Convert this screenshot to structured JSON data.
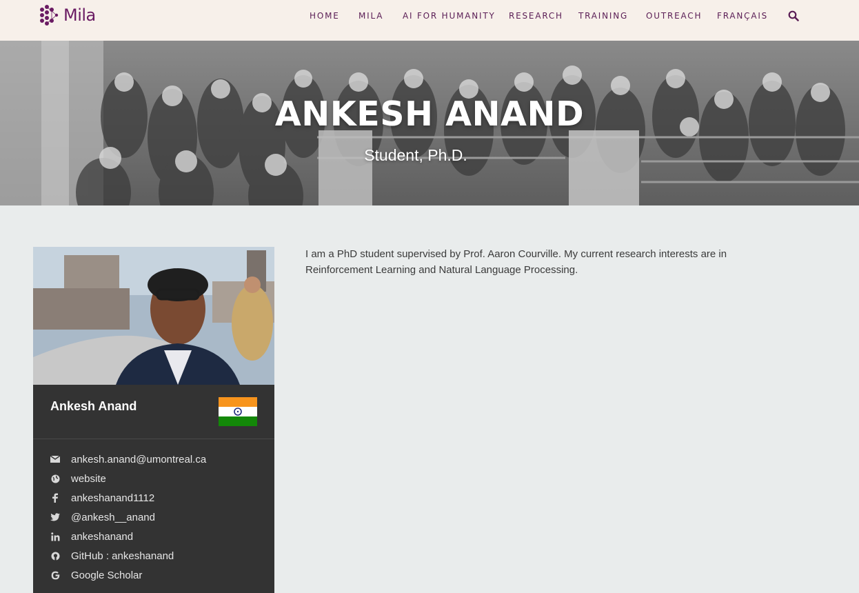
{
  "header": {
    "logo_text": "Mila",
    "nav": [
      {
        "label": "HOME"
      },
      {
        "label": "MILA"
      },
      {
        "label": "AI FOR HUMANITY"
      },
      {
        "label": "RESEARCH"
      },
      {
        "label": "TRAINING"
      },
      {
        "label": "OUTREACH"
      },
      {
        "label": "FRANÇAIS"
      }
    ],
    "search_icon": "search-icon"
  },
  "hero": {
    "title": "ANKESH ANAND",
    "subtitle": "Student, Ph.D."
  },
  "profile": {
    "name": "Ankesh Anand",
    "flag_icon": "india-flag-icon",
    "contacts": [
      {
        "icon": "envelope-icon",
        "text": "ankesh.anand@umontreal.ca"
      },
      {
        "icon": "globe-icon",
        "text": "website"
      },
      {
        "icon": "facebook-icon",
        "text": "ankeshanand1112"
      },
      {
        "icon": "twitter-icon",
        "text": "@ankesh__anand"
      },
      {
        "icon": "linkedin-icon",
        "text": "ankeshanand"
      },
      {
        "icon": "github-icon",
        "text": "GitHub : ankeshanand"
      },
      {
        "icon": "google-icon",
        "text": "Google Scholar"
      }
    ]
  },
  "bio": {
    "text": "I am a PhD student supervised by Prof. Aaron Courville. My current research interests are in Reinforcement Learning and Natural Language Processing."
  },
  "colors": {
    "brand_purple": "#6a1b63",
    "header_bg": "#f7f0ea",
    "page_bg": "#e9ecec",
    "card_bg": "#333333"
  }
}
